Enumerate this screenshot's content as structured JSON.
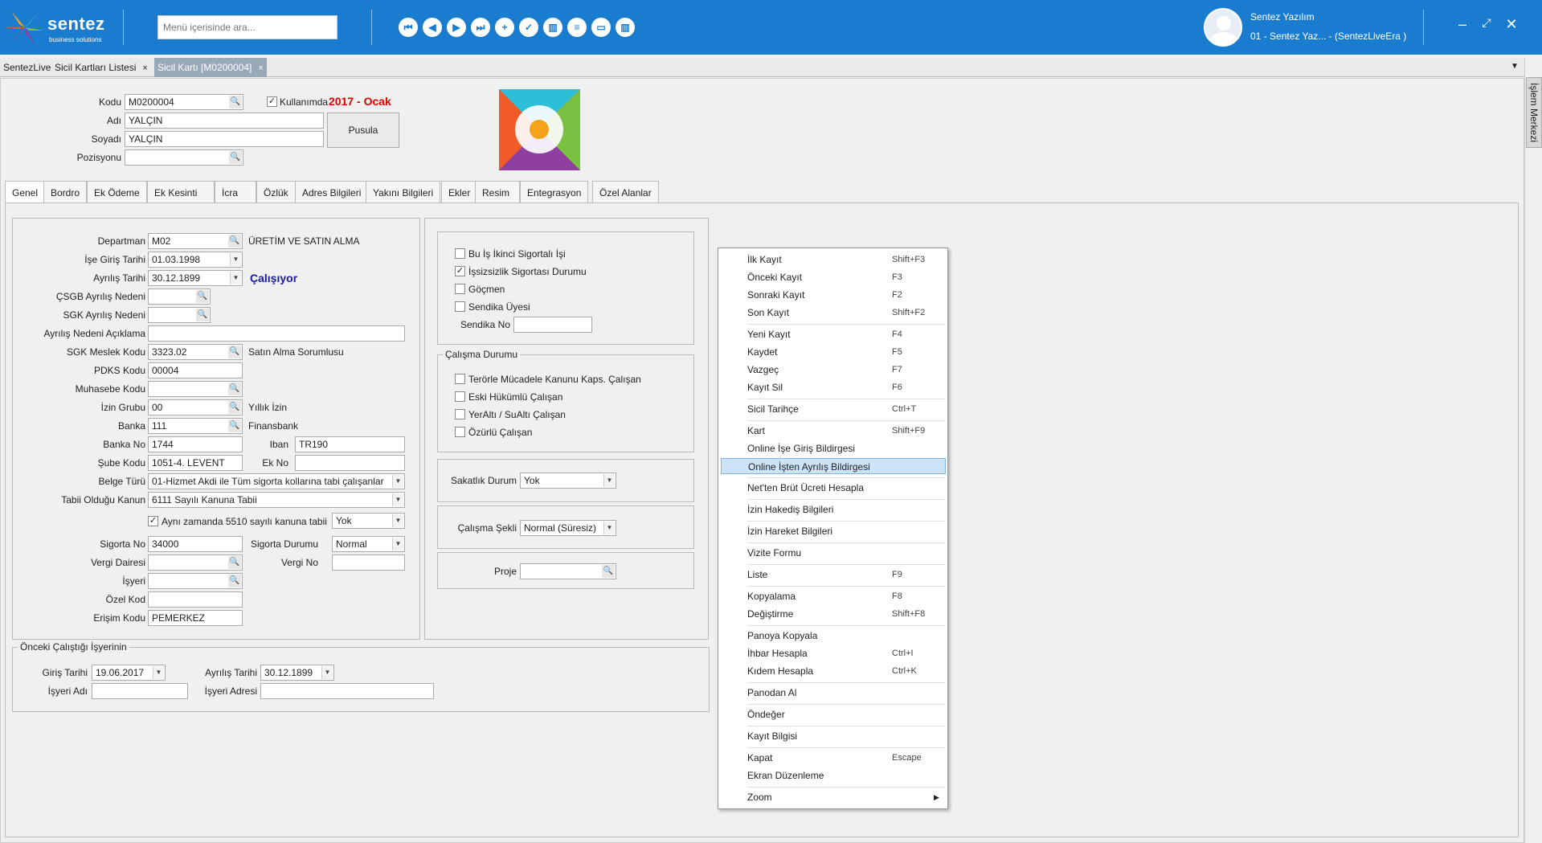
{
  "app": {
    "logo_text": "sentez",
    "logo_sub": "business solutions",
    "search_placeholder": "Menü içerisinde ara...",
    "user_name": "Sentez Yazılım",
    "user_company": "01 - Sentez Yaz... - (SentezLiveEra )",
    "nav_icons": [
      "first-icon",
      "prev-icon",
      "next-icon",
      "last-icon",
      "add-icon",
      "save-icon",
      "delete-icon",
      "list-icon",
      "window-icon",
      "trash-icon"
    ],
    "brand_color": "#1a7ccf"
  },
  "tabs": [
    {
      "label": "SentezLive"
    },
    {
      "label": "Sicil Kartları Listesi",
      "close": "×"
    },
    {
      "label": "Sicil Kartı [M0200004]",
      "close": "×"
    }
  ],
  "side_panel": "İşlem Merkezi",
  "header": {
    "kodu_label": "Kodu",
    "kodu": "M0200004",
    "kullanimda_label": "Kullanımda",
    "period": "2017 - Ocak",
    "adi_label": "Adı",
    "adi": "YALÇIN",
    "soyadi_label": "Soyadı",
    "soyadi": "YALÇIN",
    "pozisyonu_label": "Pozisyonu",
    "pusula": "Pusula"
  },
  "form_tabs": [
    "Genel",
    "Bordro",
    "Ek Ödeme",
    "Ek Kesinti",
    "İcra",
    "Özlük",
    "Adres Bilgileri",
    "Yakını Bilgileri",
    "Ekler",
    "Resim",
    "Entegrasyon",
    "Özel Alanlar"
  ],
  "genel": {
    "departman_label": "Departman",
    "departman": "M02",
    "departman_desc": "ÜRETİM VE SATIN ALMA",
    "ise_giris_label": "İşe Giriş Tarihi",
    "ise_giris": "01.03.1998",
    "ayrilis_label": "Ayrılış Tarihi",
    "ayrilis": "30.12.1899",
    "status": "Çalışıyor",
    "csgb_label": "ÇSGB Ayrılış Nedeni",
    "sgk_ayrilis_label": "SGK Ayrılış Nedeni",
    "ayrilis_aciklama_label": "Ayrılış Nedeni Açıklama",
    "meslek_label": "SGK Meslek Kodu",
    "meslek": "3323.02",
    "meslek_desc": "Satın Alma Sorumlusu",
    "pdks_label": "PDKS Kodu",
    "pdks": "00004",
    "muhasebe_label": "Muhasebe Kodu",
    "izin_label": "İzin Grubu",
    "izin": "00",
    "izin_desc": "Yıllık İzin",
    "banka_label": "Banka",
    "banka": "111",
    "banka_desc": "Finansbank",
    "banka_no_label": "Banka No",
    "banka_no": "1744",
    "iban_label": "Iban",
    "iban": "TR190",
    "sube_label": "Şube Kodu",
    "sube": "1051-4. LEVENT",
    "ekno_label": "Ek No",
    "belge_label": "Belge Türü",
    "belge": "01-Hizmet Akdi ile Tüm sigorta kollarına tabi çalışanlar",
    "kanun_label": "Tabii Olduğu Kanun",
    "kanun": "6111 Sayılı Kanuna Tabii",
    "ayni_zamanda_label": "Aynı zamanda 5510 sayılı kanuna tabii",
    "ayni_zamanda": "Yok",
    "sigorta_no_label": "Sigorta No",
    "sigorta_no": "34000",
    "sigorta_durum_label": "Sigorta Durumu",
    "sigorta_durum": "Normal",
    "vergi_dairesi_label": "Vergi Dairesi",
    "vergi_no_label": "Vergi No",
    "isyeri_label": "İşyeri",
    "ozel_kod_label": "Özel Kod",
    "erisim_label": "Erişim Kodu",
    "erisim": "PEMERKEZ"
  },
  "right_form": {
    "ikinci_sigorta": "Bu İş İkinci Sigortalı İşi",
    "issizlik": "İşsizsizlik Sigortası Durumu",
    "gocmen": "Göçmen",
    "sendika_uye": "Sendika Üyesi",
    "sendika_no_label": "Sendika No",
    "calisma_durumu_title": "Çalışma Durumu",
    "terorle": "Terörle Mücadele Kanunu Kaps. Çalışan",
    "eski_hukumlu": "Eski Hükümlü Çalışan",
    "yeralti": "YerAltı / SuAltı Çalışan",
    "ozurlu": "Özürlü Çalışan",
    "sakatlik_label": "Sakatlık Durum",
    "sakatlik": "Yok",
    "calisma_sekli_label": "Çalışma Şekli",
    "calisma_sekli": "Normal (Süresiz)",
    "proje_label": "Proje"
  },
  "onceki": {
    "title": "Önceki Çalıştığı İşyerinin",
    "giris_label": "Giriş Tarihi",
    "giris": "19.06.2017",
    "ayrilis_label": "Ayrılış Tarihi",
    "ayrilis": "30.12.1899",
    "isyeri_adi_label": "İşyeri Adı",
    "isyeri_adresi_label": "İşyeri Adresi"
  },
  "context_menu": [
    {
      "label": "İlk Kayıt",
      "shortcut": "Shift+F3"
    },
    {
      "label": "Önceki Kayıt",
      "shortcut": "F3"
    },
    {
      "label": "Sonraki Kayıt",
      "shortcut": "F2"
    },
    {
      "label": "Son Kayıt",
      "shortcut": "Shift+F2"
    },
    {
      "label": "Yeni Kayıt",
      "shortcut": "F4"
    },
    {
      "label": "Kaydet",
      "shortcut": "F5"
    },
    {
      "label": "Vazgeç",
      "shortcut": "F7"
    },
    {
      "label": "Kayıt Sil",
      "shortcut": "F6"
    },
    {
      "label": "Sicil Tarihçe",
      "shortcut": "Ctrl+T"
    },
    {
      "label": "Kart",
      "shortcut": "Shift+F9"
    },
    {
      "label": "Online İşe Giriş Bildirgesi",
      "shortcut": ""
    },
    {
      "label": "Online İşten Ayrılış Bildirgesi",
      "shortcut": ""
    },
    {
      "label": "Net'ten Brüt Ücreti Hesapla",
      "shortcut": ""
    },
    {
      "label": "İzin Hakediş Bilgileri",
      "shortcut": ""
    },
    {
      "label": "İzin Hareket Bilgileri",
      "shortcut": ""
    },
    {
      "label": "Vizite Formu",
      "shortcut": ""
    },
    {
      "label": "Liste",
      "shortcut": "F9"
    },
    {
      "label": "Kopyalama",
      "shortcut": "F8"
    },
    {
      "label": "Değiştirme",
      "shortcut": "Shift+F8"
    },
    {
      "label": "Panoya Kopyala",
      "shortcut": ""
    },
    {
      "label": "İhbar Hesapla",
      "shortcut": "Ctrl+I"
    },
    {
      "label": "Kıdem Hesapla",
      "shortcut": "Ctrl+K"
    },
    {
      "label": "Panodan Al",
      "shortcut": ""
    },
    {
      "label": "Öndeğer",
      "shortcut": ""
    },
    {
      "label": "Kayıt Bilgisi",
      "shortcut": ""
    },
    {
      "label": "Kapat",
      "shortcut": "Escape"
    },
    {
      "label": "Ekran Düzenleme",
      "shortcut": ""
    },
    {
      "label": "Zoom",
      "shortcut": ""
    }
  ]
}
